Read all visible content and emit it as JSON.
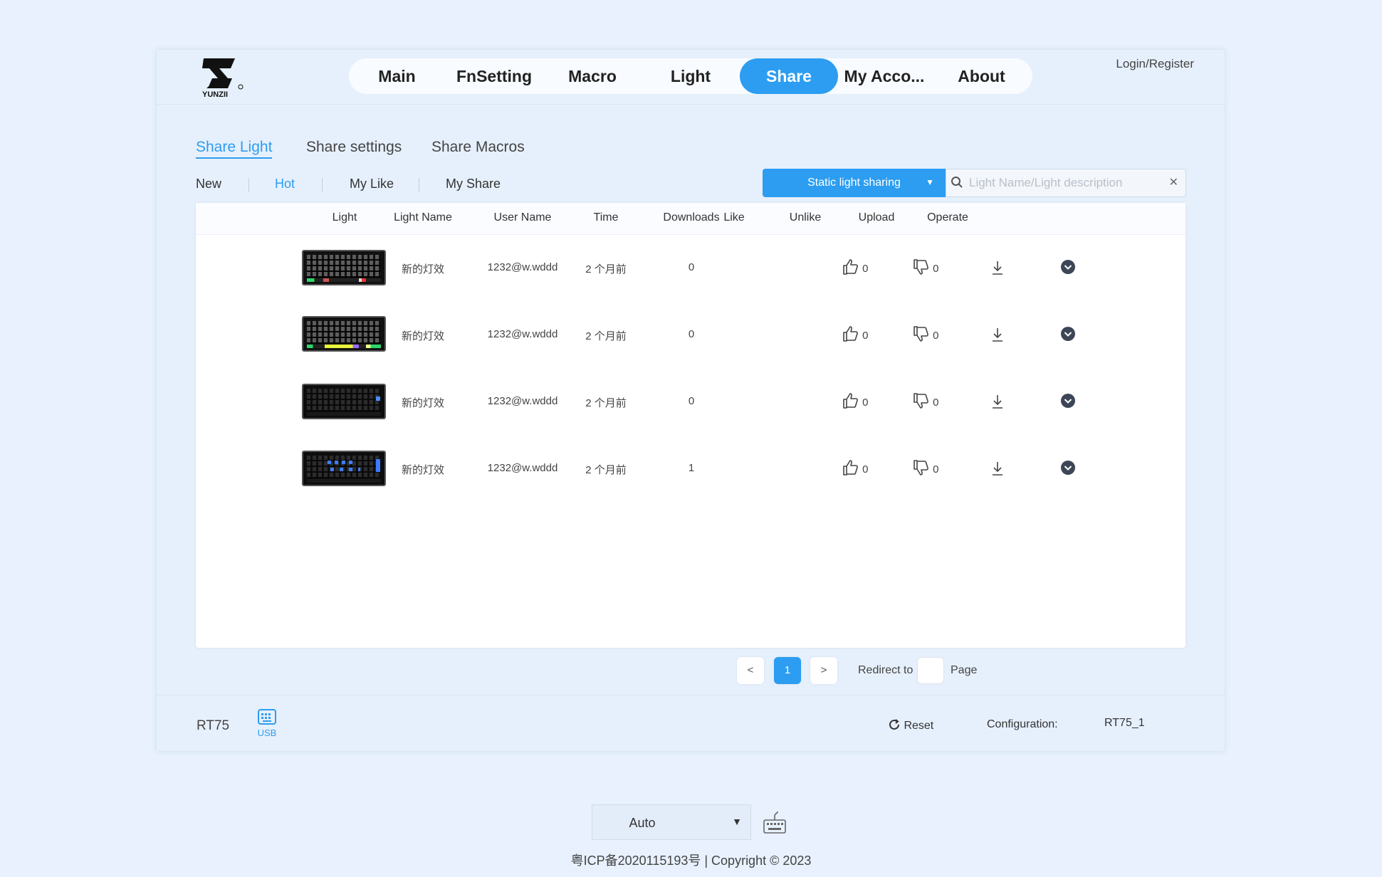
{
  "brand": {
    "logo_text": "YUNZII"
  },
  "nav": {
    "items": [
      "Main",
      "FnSetting",
      "Macro",
      "Light",
      "Share",
      "My Acco...",
      "About"
    ],
    "active": "Share"
  },
  "login_label": "Login/Register",
  "subtabs": {
    "items": [
      "Share Light",
      "Share settings",
      "Share Macros"
    ],
    "active": "Share Light"
  },
  "filters": {
    "items": [
      "New",
      "Hot",
      "My Like",
      "My Share"
    ],
    "active": "Hot"
  },
  "share_type": {
    "selected": "Static light sharing"
  },
  "search": {
    "placeholder": "Light Name/Light description",
    "value": ""
  },
  "table": {
    "headers": [
      "Light",
      "Light Name",
      "User Name",
      "Time",
      "Downloads",
      "Like",
      "Unlike",
      "Upload",
      "Operate"
    ],
    "rows": [
      {
        "light_name": "新的灯效",
        "user_name": "1232@w.wddd",
        "time": "2 个月前",
        "downloads": "0",
        "like": "0",
        "unlike": "0"
      },
      {
        "light_name": "新的灯效",
        "user_name": "1232@w.wddd",
        "time": "2 个月前",
        "downloads": "0",
        "like": "0",
        "unlike": "0"
      },
      {
        "light_name": "新的灯效",
        "user_name": "1232@w.wddd",
        "time": "2 个月前",
        "downloads": "0",
        "like": "0",
        "unlike": "0"
      },
      {
        "light_name": "新的灯效",
        "user_name": "1232@w.wddd",
        "time": "2 个月前",
        "downloads": "1",
        "like": "0",
        "unlike": "0"
      }
    ]
  },
  "pagination": {
    "prev": "<",
    "current": "1",
    "next": ">",
    "redirect_label": "Redirect to",
    "page_label": "Page"
  },
  "footer": {
    "model": "RT75",
    "connection": "USB",
    "reset_label": "Reset",
    "config_label": "Configuration:",
    "config_value": "RT75_1"
  },
  "mode_select": {
    "selected": "Auto"
  },
  "copyright": "粤ICP备2020115193号 | Copyright © 2023",
  "colors": {
    "accent": "#2c9df1",
    "background": "#e8f1fd"
  }
}
